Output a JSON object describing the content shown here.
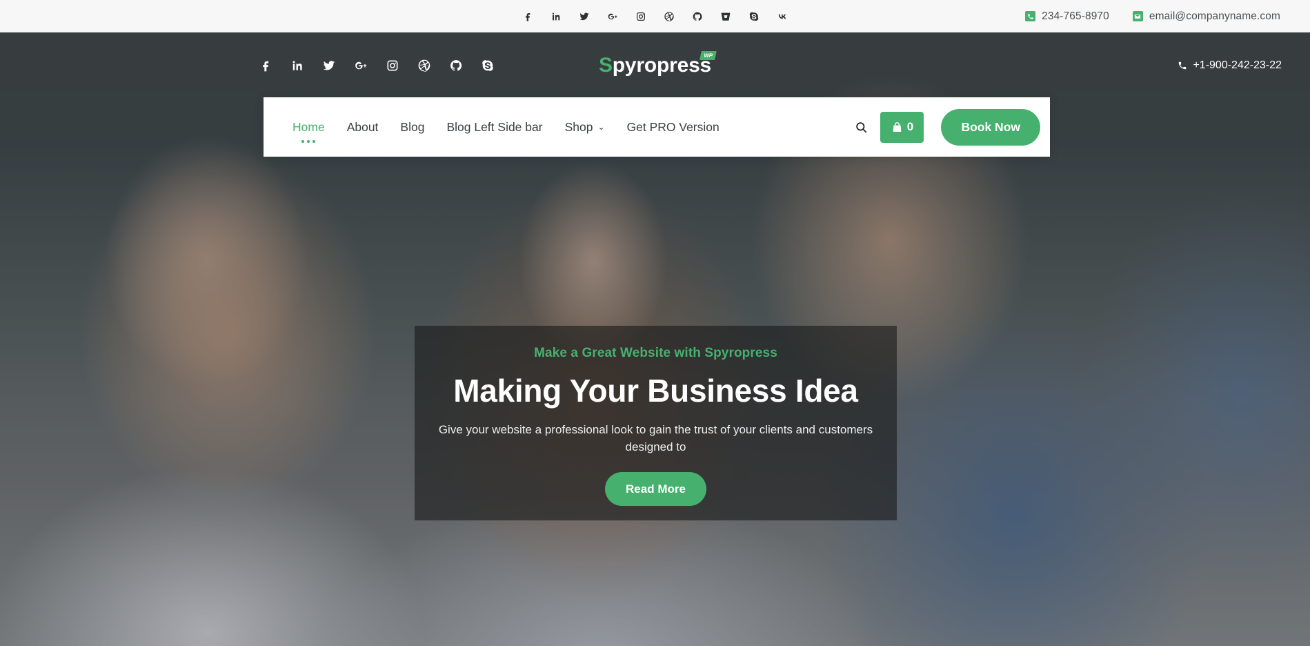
{
  "topbar": {
    "social": [
      {
        "name": "facebook-icon",
        "label": "Facebook"
      },
      {
        "name": "linkedin-icon",
        "label": "LinkedIn"
      },
      {
        "name": "twitter-icon",
        "label": "Twitter"
      },
      {
        "name": "google-plus-icon",
        "label": "Google Plus"
      },
      {
        "name": "instagram-icon",
        "label": "Instagram"
      },
      {
        "name": "dribbble-icon",
        "label": "Dribbble"
      },
      {
        "name": "github-icon",
        "label": "GitHub"
      },
      {
        "name": "bitbucket-icon",
        "label": "Bitbucket"
      },
      {
        "name": "skype-icon",
        "label": "Skype"
      },
      {
        "name": "vk-icon",
        "label": "VK"
      }
    ],
    "phone": "234-765-8970",
    "email": "email@companyname.com"
  },
  "header": {
    "social": [
      {
        "name": "facebook-icon",
        "label": "Facebook"
      },
      {
        "name": "linkedin-icon",
        "label": "LinkedIn"
      },
      {
        "name": "twitter-icon",
        "label": "Twitter"
      },
      {
        "name": "google-plus-icon",
        "label": "Google Plus"
      },
      {
        "name": "instagram-icon",
        "label": "Instagram"
      },
      {
        "name": "dribbble-icon",
        "label": "Dribbble"
      },
      {
        "name": "github-icon",
        "label": "GitHub"
      },
      {
        "name": "skype-icon",
        "label": "Skype"
      }
    ],
    "logo_s": "S",
    "logo_rest": "pyropress",
    "logo_badge": "WP",
    "phone": "+1-900-242-23-22"
  },
  "nav": {
    "items": [
      {
        "label": "Home",
        "active": true,
        "has_caret": false
      },
      {
        "label": "About",
        "active": false,
        "has_caret": false
      },
      {
        "label": "Blog",
        "active": false,
        "has_caret": false
      },
      {
        "label": "Blog Left Side bar",
        "active": false,
        "has_caret": false
      },
      {
        "label": "Shop",
        "active": false,
        "has_caret": true
      },
      {
        "label": "Get PRO Version",
        "active": false,
        "has_caret": false
      }
    ],
    "caret": "⌄",
    "search_icon": "search-icon",
    "cart_count": "0",
    "book_label": "Book Now"
  },
  "hero": {
    "subtitle": "Make a Great Website with Spyropress",
    "title": "Making Your Business Idea",
    "description": "Give your website a professional look to gain the trust of your clients and customers designed to",
    "button": "Read More"
  },
  "colors": {
    "accent_green": "#46b16f",
    "topbar_bg": "#f7f7f7",
    "nav_bg": "#ffffff",
    "text_dark": "#3c4043",
    "hero_box_bg": "rgba(26,28,28,.62)"
  }
}
